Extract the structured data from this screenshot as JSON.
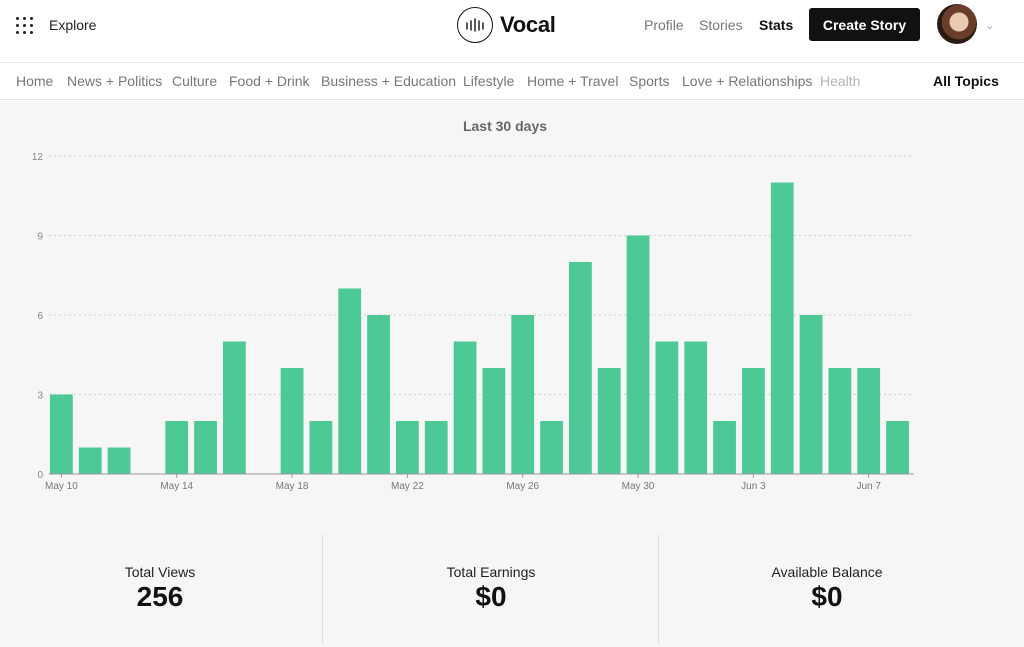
{
  "header": {
    "explore_label": "Explore",
    "logo_text": "Vocal",
    "nav": [
      "Profile",
      "Stories",
      "Stats"
    ],
    "active_nav": "Stats",
    "create_label": "Create Story"
  },
  "topics": {
    "items": [
      "Home",
      "News + Politics",
      "Culture",
      "Food + Drink",
      "Business + Education",
      "Lifestyle",
      "Home + Travel",
      "Sports",
      "Love + Relationships",
      "Health"
    ],
    "all_topics_label": "All Topics"
  },
  "stats": {
    "total_views_label": "Total Views",
    "total_views": "256",
    "total_earnings_label": "Total Earnings",
    "total_earnings": "$0",
    "available_balance_label": "Available Balance",
    "available_balance": "$0"
  },
  "colors": {
    "bar": "#4cc995",
    "grid": "#d0d0d0"
  },
  "chart_data": {
    "type": "bar",
    "title": "Last 30 days",
    "ylim": [
      0,
      12
    ],
    "yticks": [
      0,
      3,
      6,
      9,
      12
    ],
    "categories": [
      "May 10",
      "May 11",
      "May 12",
      "May 13",
      "May 14",
      "May 15",
      "May 16",
      "May 17",
      "May 18",
      "May 19",
      "May 20",
      "May 21",
      "May 22",
      "May 23",
      "May 24",
      "May 25",
      "May 26",
      "May 27",
      "May 28",
      "May 29",
      "May 30",
      "May 31",
      "Jun 1",
      "Jun 2",
      "Jun 3",
      "Jun 4",
      "Jun 5",
      "Jun 6",
      "Jun 7",
      "Jun 8"
    ],
    "values": [
      3,
      1,
      1,
      0,
      2,
      2,
      5,
      0,
      4,
      2,
      7,
      6,
      2,
      2,
      5,
      4,
      6,
      2,
      8,
      4,
      9,
      5,
      5,
      2,
      4,
      11,
      6,
      4,
      4,
      2
    ],
    "xtick_labels": [
      "May 10",
      "May 14",
      "May 18",
      "May 22",
      "May 26",
      "May 30",
      "Jun 3",
      "Jun 7"
    ],
    "grid": true,
    "legend": "none"
  }
}
